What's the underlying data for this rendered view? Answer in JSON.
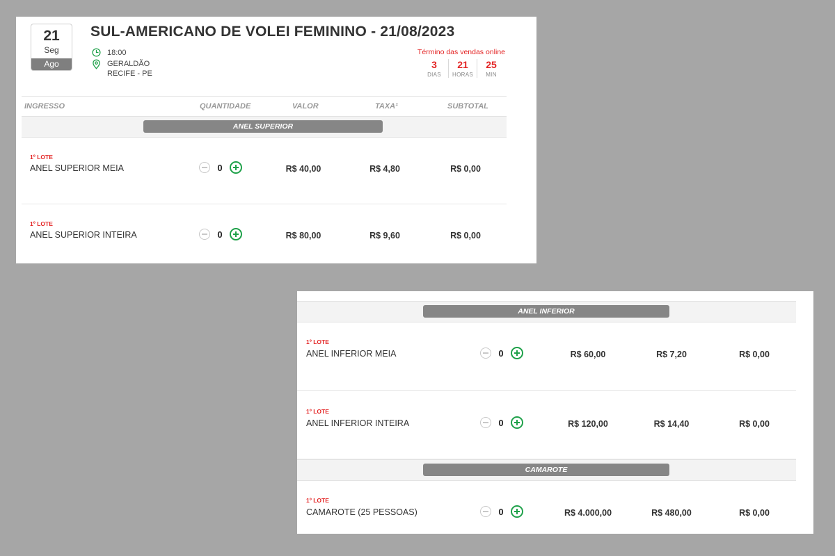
{
  "event": {
    "day": "21",
    "weekday": "Seg",
    "month": "Ago",
    "title": "SUL-AMERICANO DE VOLEI FEMININO - 21/08/2023",
    "time": "18:00",
    "venue": "GERALDÃO",
    "city": "RECIFE - PE"
  },
  "sales": {
    "title": "Término das vendas online",
    "countdown": [
      {
        "value": "3",
        "unit": "DIAS"
      },
      {
        "value": "21",
        "unit": "HORAS"
      },
      {
        "value": "25",
        "unit": "MIN"
      }
    ]
  },
  "table_header": {
    "ingresso": "INGRESSO",
    "quantidade": "QUANTIDADE",
    "valor": "VALOR",
    "taxa": "TAXA¹",
    "subtotal": "SUBTOTAL"
  },
  "sections": [
    {
      "name": "ANEL SUPERIOR"
    },
    {
      "name": "ANEL INFERIOR"
    },
    {
      "name": "CAMAROTE"
    }
  ],
  "tickets": [
    {
      "lote": "1º LOTE",
      "name": "ANEL SUPERIOR MEIA",
      "qty": "0",
      "valor": "R$ 40,00",
      "taxa": "R$ 4,80",
      "subtotal": "R$ 0,00"
    },
    {
      "lote": "1º LOTE",
      "name": "ANEL SUPERIOR INTEIRA",
      "qty": "0",
      "valor": "R$ 80,00",
      "taxa": "R$ 9,60",
      "subtotal": "R$ 0,00"
    },
    {
      "lote": "1º LOTE",
      "name": "ANEL INFERIOR MEIA",
      "qty": "0",
      "valor": "R$ 60,00",
      "taxa": "R$ 7,20",
      "subtotal": "R$ 0,00"
    },
    {
      "lote": "1º LOTE",
      "name": "ANEL INFERIOR INTEIRA",
      "qty": "0",
      "valor": "R$ 120,00",
      "taxa": "R$ 14,40",
      "subtotal": "R$ 0,00"
    },
    {
      "lote": "1º LOTE",
      "name": "CAMAROTE (25 PESSOAS)",
      "qty": "0",
      "valor": "R$ 4.000,00",
      "taxa": "R$ 480,00",
      "subtotal": "R$ 0,00"
    }
  ],
  "colors": {
    "accent_red": "#e32323",
    "plus_green": "#1fa14a",
    "section_gray": "#868686",
    "background": "#a6a6a6"
  },
  "icons": {
    "time": "clock-icon",
    "location": "location-pin-icon",
    "increment": "plus-circle-icon",
    "decrement": "minus-circle-icon"
  }
}
